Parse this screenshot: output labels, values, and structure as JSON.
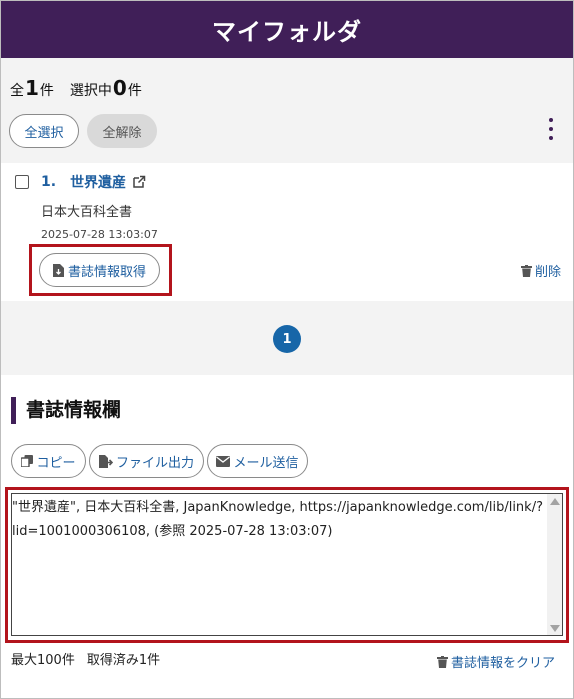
{
  "header": {
    "title": "マイフォルダ"
  },
  "summary": {
    "total_prefix": "全",
    "total_count": "1",
    "total_suffix": "件",
    "selected_prefix": "選択中",
    "selected_count": "0",
    "selected_suffix": "件"
  },
  "toolbar": {
    "select_all_label": "全選択",
    "clear_all_label": "全解除",
    "more_icon": "kebab-menu-icon"
  },
  "items": [
    {
      "number": "1.",
      "title": "世界遺産",
      "source": "日本大百科全書",
      "date": "2025-07-28 13:03:07",
      "biblio_button_label": "書誌情報取得",
      "delete_label": "削除"
    }
  ],
  "pagination": {
    "current_page": "1"
  },
  "biblio_section": {
    "title": "書誌情報欄",
    "copy_label": "コピー",
    "file_label": "ファイル出力",
    "mail_label": "メール送信",
    "text": "\"世界遺産\", 日本大百科全書, JapanKnowledge, https://japanknowledge.com/lib/link/?lid=1001000306108, (参照 2025-07-28 13:03:07)",
    "max_label": "最大100件",
    "acquired_label": "取得済み1件",
    "clear_label": "書誌情報をクリア"
  },
  "colors": {
    "header_bg": "#401f58",
    "link_blue": "#1f5fa0",
    "highlight_red": "#b3141c",
    "page_badge": "#1766a8"
  }
}
